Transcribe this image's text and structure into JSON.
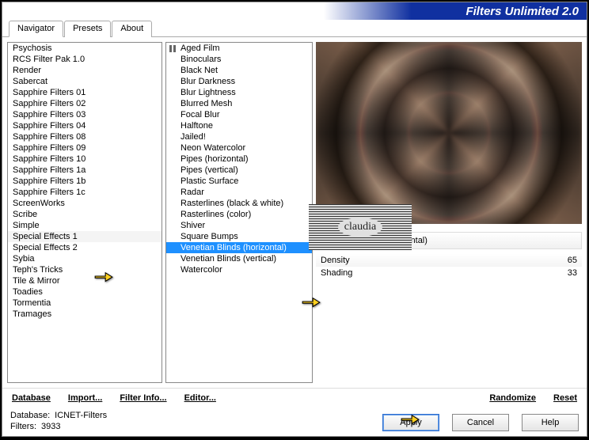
{
  "title": "Filters Unlimited 2.0",
  "tabs": [
    "Navigator",
    "Presets",
    "About"
  ],
  "active_tab": 0,
  "categories": [
    "Psychosis",
    "RCS Filter Pak 1.0",
    "Render",
    "Sabercat",
    "Sapphire Filters 01",
    "Sapphire Filters 02",
    "Sapphire Filters 03",
    "Sapphire Filters 04",
    "Sapphire Filters 08",
    "Sapphire Filters 09",
    "Sapphire Filters 10",
    "Sapphire Filters 1a",
    "Sapphire Filters 1b",
    "Sapphire Filters 1c",
    "ScreenWorks",
    "Scribe",
    "Simple",
    "Special Effects 1",
    "Special Effects 2",
    "Sybia",
    "Teph's Tricks",
    "Tile & Mirror",
    "Toadies",
    "Tormentia",
    "Tramages"
  ],
  "category_highlight": 17,
  "filters": [
    "Aged Film",
    "Binoculars",
    "Black Net",
    "Blur Darkness",
    "Blur Lightness",
    "Blurred Mesh",
    "Focal Blur",
    "Halftone",
    "Jailed!",
    "Neon Watercolor",
    "Pipes (horizontal)",
    "Pipes (vertical)",
    "Plastic Surface",
    "Radar",
    "Rasterlines (black & white)",
    "Rasterlines (color)",
    "Shiver",
    "Square Bumps",
    "Venetian Blinds (horizontal)",
    "Venetian Blinds (vertical)",
    "Watercolor"
  ],
  "filter_selected": 18,
  "selected_filter_name": "Venetian Blinds (horizontal)",
  "params": [
    {
      "name": "Density",
      "value": 65
    },
    {
      "name": "Shading",
      "value": 33
    }
  ],
  "link_buttons": {
    "database": "Database",
    "import": "Import...",
    "filterinfo": "Filter Info...",
    "editor": "Editor...",
    "randomize": "Randomize",
    "reset": "Reset"
  },
  "status": {
    "db_label": "Database:",
    "db_value": "ICNET-Filters",
    "filters_label": "Filters:",
    "filters_value": "3933"
  },
  "buttons": {
    "apply": "Apply",
    "cancel": "Cancel",
    "help": "Help"
  },
  "watermark": "claudia"
}
